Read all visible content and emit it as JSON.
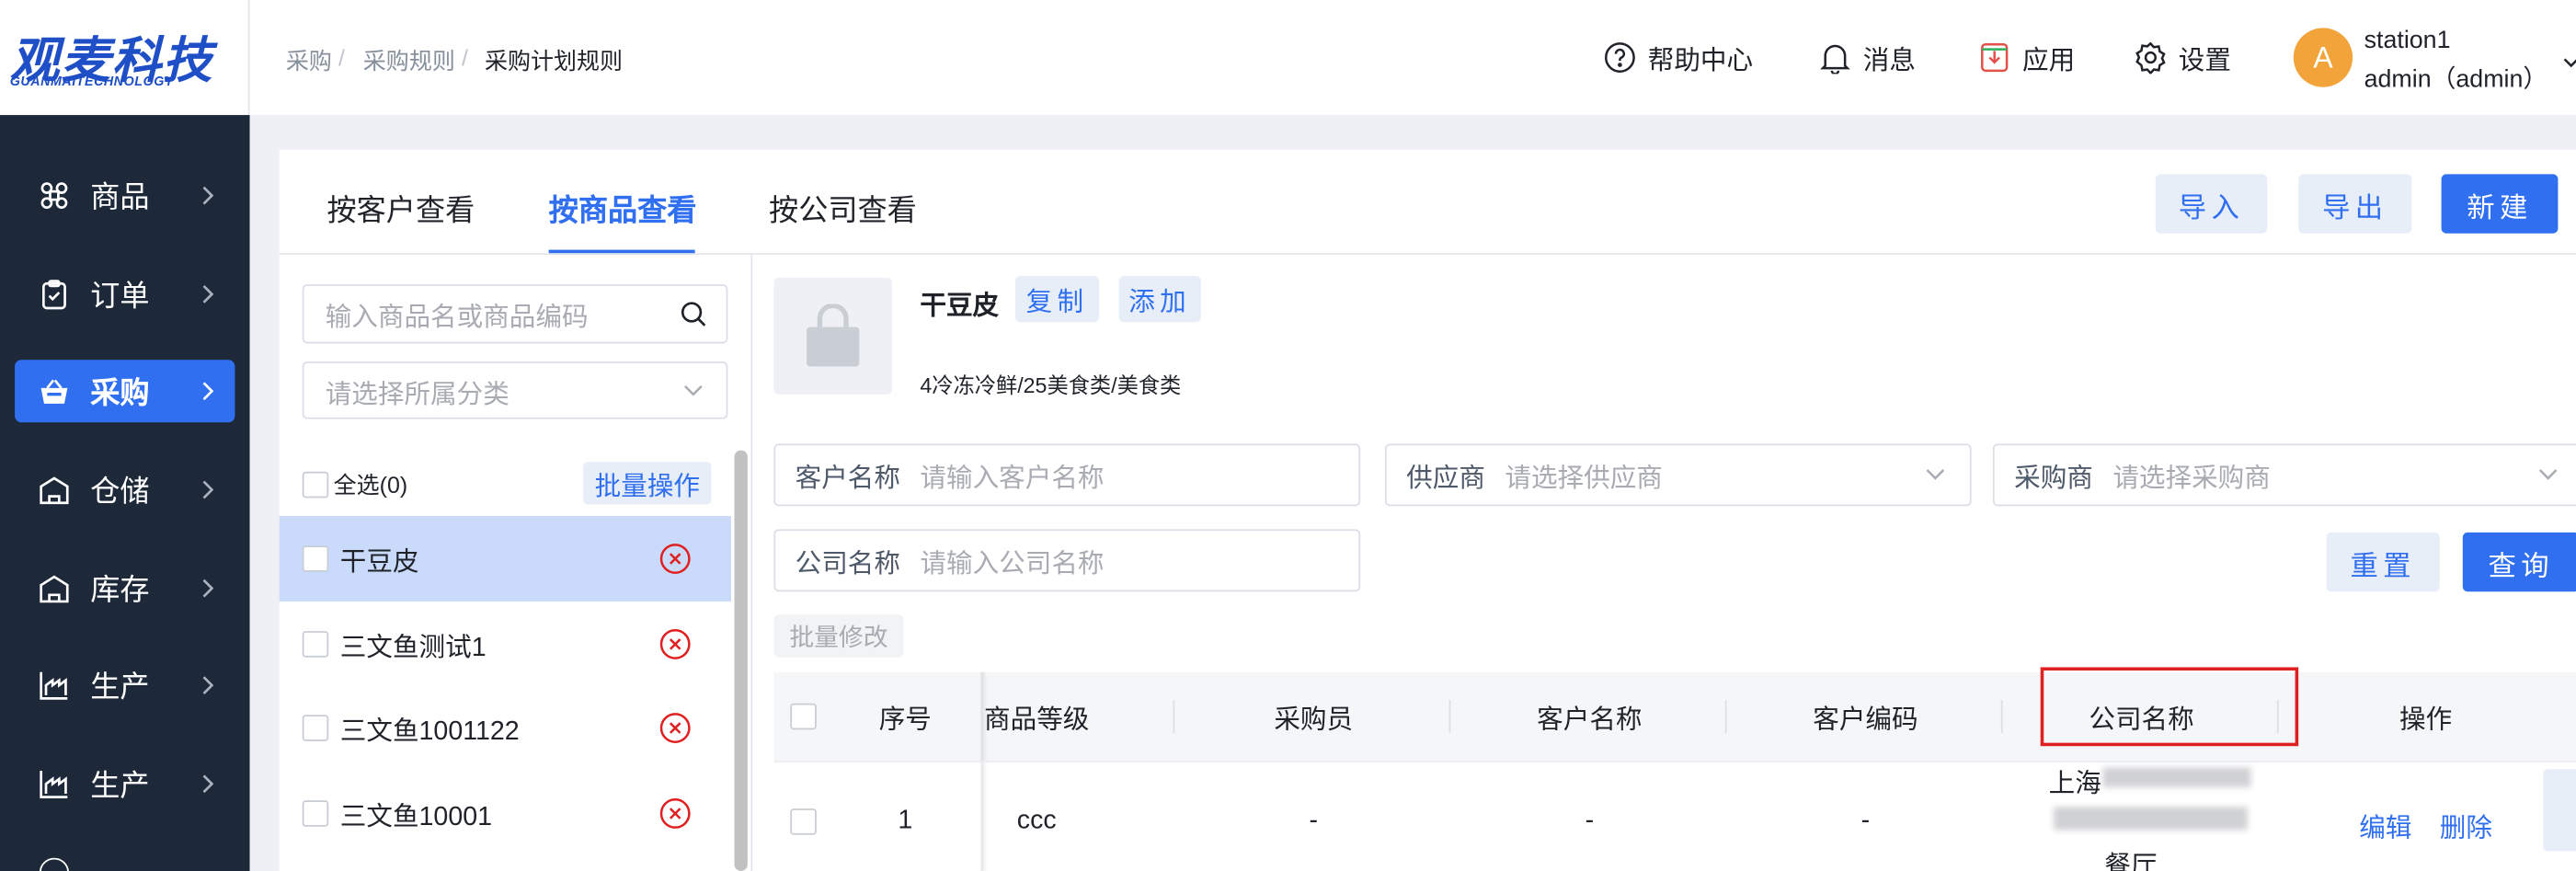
{
  "logo": {
    "text": "观麦科技",
    "subtext": "GUANMAITECHNOLOGY"
  },
  "sidebar": {
    "items": [
      {
        "label": "商品",
        "icon": "command-icon",
        "active": false
      },
      {
        "label": "订单",
        "icon": "clipboard-icon",
        "active": false
      },
      {
        "label": "采购",
        "icon": "basket-icon",
        "active": true
      },
      {
        "label": "仓储",
        "icon": "warehouse-icon",
        "active": false
      },
      {
        "label": "库存",
        "icon": "warehouse-icon",
        "active": false
      },
      {
        "label": "生产",
        "icon": "factory-icon",
        "active": false
      },
      {
        "label": "生产",
        "icon": "factory-icon",
        "active": false
      }
    ]
  },
  "header": {
    "breadcrumb": [
      "采购",
      "采购规则",
      "采购计划规则"
    ],
    "help": "帮助中心",
    "messages": "消息",
    "apps": "应用",
    "settings": "设置",
    "avatar_letter": "A",
    "station": "station1",
    "user": "admin（admin）"
  },
  "tabs": [
    "按客户查看",
    "按商品查看",
    "按公司查看"
  ],
  "actions": {
    "import": "导入",
    "export": "导出",
    "create": "新建"
  },
  "left_panel": {
    "search_placeholder": "输入商品名或商品编码",
    "category_placeholder": "请选择所属分类",
    "select_all": "全选(0)",
    "batch_ops": "批量操作",
    "products": [
      {
        "name": "干豆皮",
        "selected": true
      },
      {
        "name": "三文鱼测试1",
        "selected": false
      },
      {
        "name": "三文鱼1001122",
        "selected": false
      },
      {
        "name": "三文鱼10001",
        "selected": false
      }
    ]
  },
  "product": {
    "name": "干豆皮",
    "copy": "复制",
    "add": "添加",
    "category": "4冷冻冷鲜/25美食类/美食类"
  },
  "filters": {
    "customer_label": "客户名称",
    "customer_placeholder": "请输入客户名称",
    "supplier_label": "供应商",
    "supplier_placeholder": "请选择供应商",
    "purchaser_label": "采购商",
    "purchaser_placeholder": "请选择采购商",
    "company_label": "公司名称",
    "company_placeholder": "请输入公司名称",
    "reset": "重置",
    "query": "查询",
    "batch_edit": "批量修改"
  },
  "table": {
    "columns": [
      "序号",
      "商品等级",
      "采购员",
      "客户名称",
      "客户编码",
      "公司名称",
      "操作"
    ],
    "rows": [
      {
        "index": "1",
        "grade": "ccc",
        "buyer": "-",
        "customer": "-",
        "code": "-",
        "company_prefix": "上海",
        "company_suffix": "餐厅",
        "edit": "编辑",
        "delete": "删除"
      }
    ]
  },
  "colors": {
    "accent": "#2f6ff0",
    "sidebar": "#1d2939",
    "highlight": "#e02020",
    "avatar": "#f2a33a"
  }
}
